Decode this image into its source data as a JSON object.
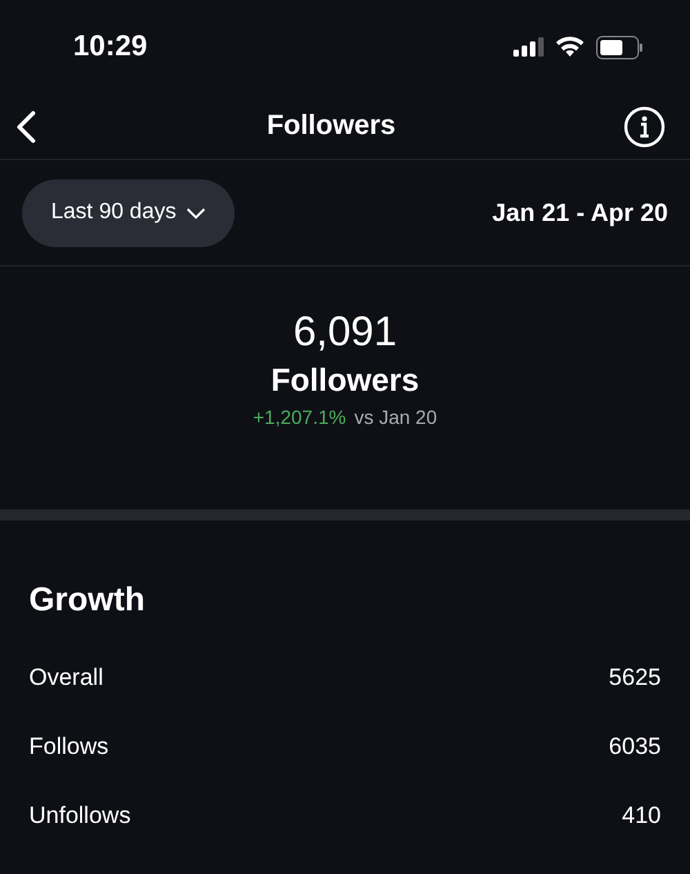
{
  "status_bar": {
    "time": "10:29"
  },
  "nav": {
    "title": "Followers"
  },
  "filter": {
    "range": "Last 90 days",
    "dates": "Jan 21 - Apr 20"
  },
  "summary": {
    "value": "6,091",
    "label": "Followers",
    "change": "+1,207.1%",
    "comparison": "vs Jan 20"
  },
  "growth": {
    "title": "Growth",
    "rows": [
      {
        "label": "Overall",
        "value": "5625"
      },
      {
        "label": "Follows",
        "value": "6035"
      },
      {
        "label": "Unfollows",
        "value": "410"
      }
    ]
  }
}
